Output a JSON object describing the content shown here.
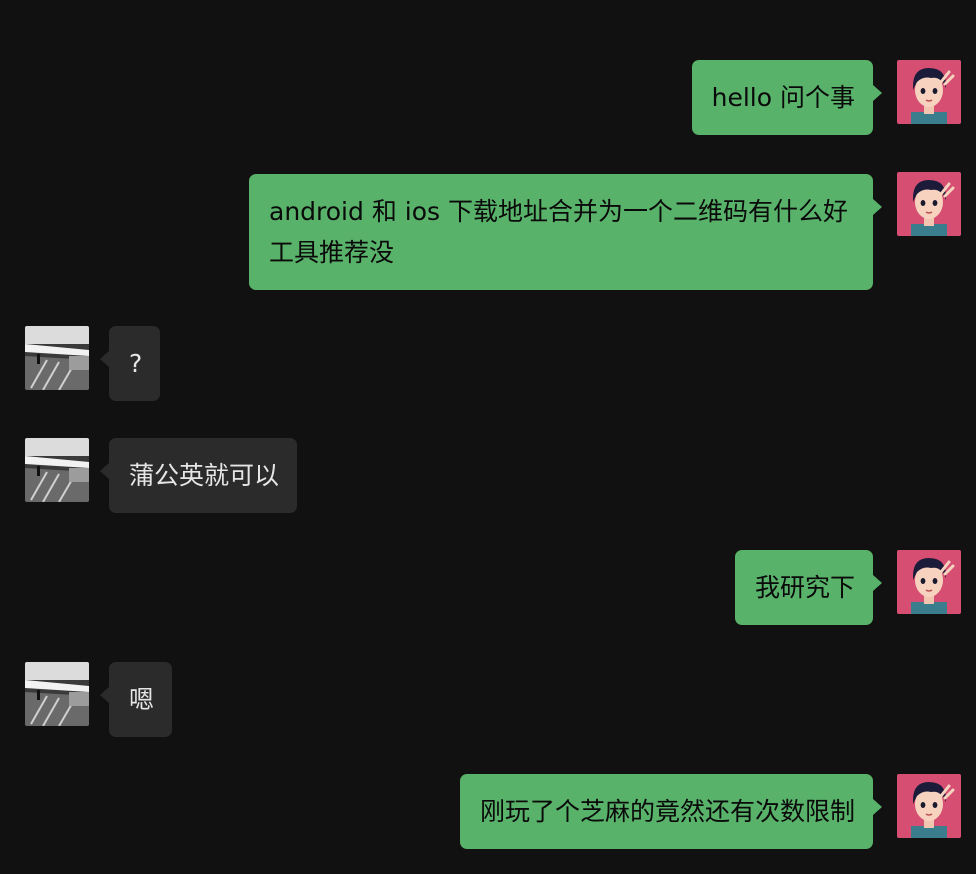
{
  "colors": {
    "background": "#111111",
    "my_bubble": "#59b26a",
    "other_bubble": "#2b2b2b"
  },
  "messages": [
    {
      "sender": "me",
      "text": "hello 问个事"
    },
    {
      "sender": "me",
      "text": "android 和 ios 下载地址合并为一个二维码有什么好工具推荐没"
    },
    {
      "sender": "other",
      "text": "?"
    },
    {
      "sender": "other",
      "text": "蒲公英就可以"
    },
    {
      "sender": "me",
      "text": "我研究下"
    },
    {
      "sender": "other",
      "text": "嗯"
    },
    {
      "sender": "me",
      "text": "刚玩了个芝麻的竟然还有次数限制"
    }
  ]
}
